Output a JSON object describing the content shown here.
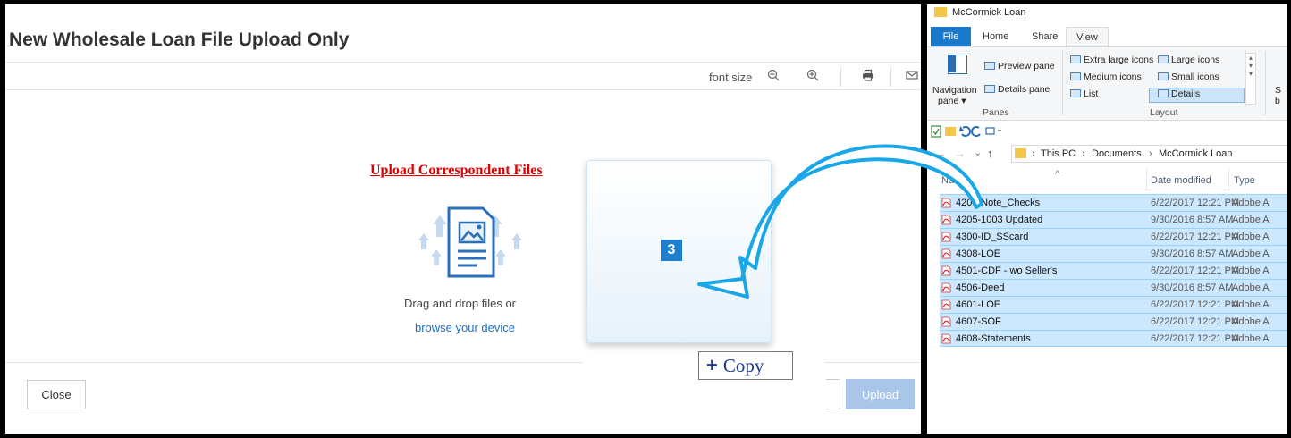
{
  "modal": {
    "title": "New Wholesale Loan File Upload Only",
    "font_size_label": "font size",
    "upload_link": "Upload Correspondent Files",
    "drag_text": "Drag and drop files or",
    "browse_link": "browse your device",
    "close_label": "Close",
    "upload_label": "Upload"
  },
  "drag": {
    "count": "3",
    "copy_label": "Copy",
    "copy_symbol": "+"
  },
  "explorer": {
    "window_title": "McCormick Loan",
    "tabs": {
      "file": "File",
      "home": "Home",
      "share": "Share",
      "view": "View"
    },
    "ribbon": {
      "nav_pane": "Navigation",
      "nav_pane2": "pane ▾",
      "preview_pane": "Preview pane",
      "details_pane": "Details pane",
      "panes_group": "Panes",
      "extra_large": "Extra large icons",
      "large": "Large icons",
      "medium": "Medium icons",
      "small": "Small icons",
      "list": "List",
      "details": "Details",
      "layout_group": "Layout",
      "sort_s": "S",
      "sort_b": "b"
    },
    "breadcrumb": {
      "this_pc": "This PC",
      "documents": "Documents",
      "folder": "McCormick Loan"
    },
    "columns": {
      "name": "Name",
      "date": "Date modified",
      "type": "Type"
    },
    "files": [
      {
        "name": "4203-Note_Checks",
        "date": "6/22/2017 12:21 PM",
        "type": "Adobe A"
      },
      {
        "name": "4205-1003 Updated",
        "date": "9/30/2016 8:57 AM",
        "type": "Adobe A"
      },
      {
        "name": "4300-ID_SScard",
        "date": "6/22/2017 12:21 PM",
        "type": "Adobe A"
      },
      {
        "name": "4308-LOE",
        "date": "9/30/2016 8:57 AM",
        "type": "Adobe A"
      },
      {
        "name": "4501-CDF - wo Seller's",
        "date": "6/22/2017 12:21 PM",
        "type": "Adobe A"
      },
      {
        "name": "4506-Deed",
        "date": "9/30/2016 8:57 AM",
        "type": "Adobe A"
      },
      {
        "name": "4601-LOE",
        "date": "6/22/2017 12:21 PM",
        "type": "Adobe A"
      },
      {
        "name": "4607-SOF",
        "date": "6/22/2017 12:21 PM",
        "type": "Adobe A"
      },
      {
        "name": "4608-Statements",
        "date": "6/22/2017 12:21 PM",
        "type": "Adobe A"
      }
    ]
  },
  "colors": {
    "link_red": "#e00000",
    "accent_blue": "#1979ca",
    "selection": "#cce8ff",
    "arrow": "#1aa7e8"
  },
  "icons": [
    "zoom-out-icon",
    "zoom-in-icon",
    "print-icon",
    "mail-icon",
    "upload-document-icon",
    "pdf-file-icon",
    "folder-icon",
    "drag-arrow-icon"
  ]
}
